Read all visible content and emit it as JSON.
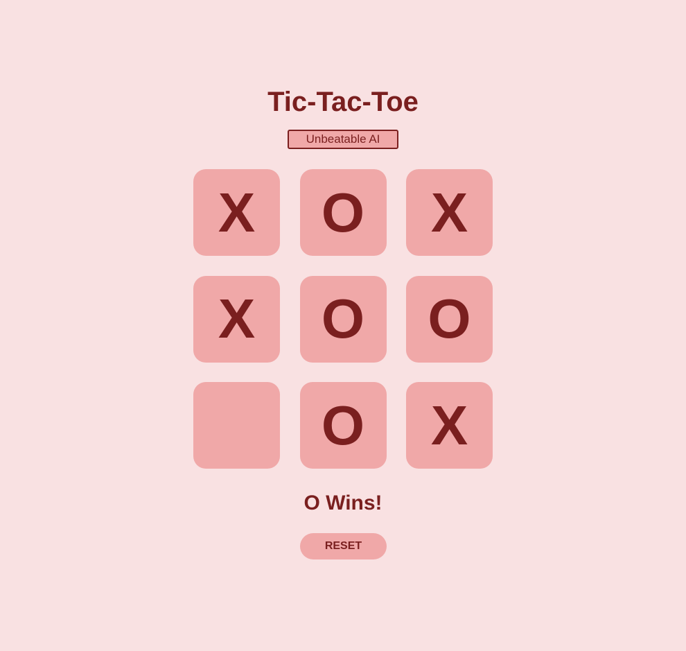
{
  "game": {
    "title": "Tic-Tac-Toe",
    "mode": "Unbeatable AI",
    "status": "O Wins!",
    "reset_label": "RESET",
    "board": [
      "X",
      "O",
      "X",
      "X",
      "O",
      "O",
      "",
      "O",
      "X"
    ]
  },
  "colors": {
    "background": "#f9e1e2",
    "cell": "#f0a8a8",
    "text": "#7a1f1f"
  }
}
